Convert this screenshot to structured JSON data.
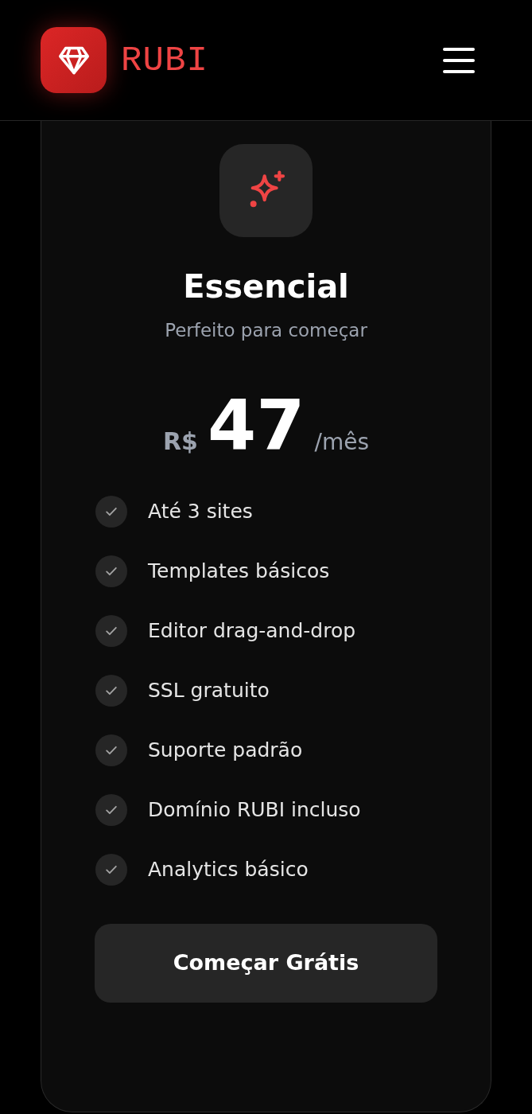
{
  "header": {
    "brand": "RUBI"
  },
  "plan": {
    "name": "Essencial",
    "tagline": "Perfeito para começar",
    "currency": "R$",
    "price": "47",
    "period": "/mês",
    "features": [
      {
        "label": "Até 3 sites",
        "included": true
      },
      {
        "label": "Templates básicos",
        "included": true
      },
      {
        "label": "Editor drag-and-drop",
        "included": true
      },
      {
        "label": "SSL gratuito",
        "included": true
      },
      {
        "label": "Suporte padrão",
        "included": true
      },
      {
        "label": "Domínio RUBI incluso",
        "included": true
      },
      {
        "label": "Analytics básico",
        "included": true
      }
    ],
    "button": "Começar Grátis"
  }
}
